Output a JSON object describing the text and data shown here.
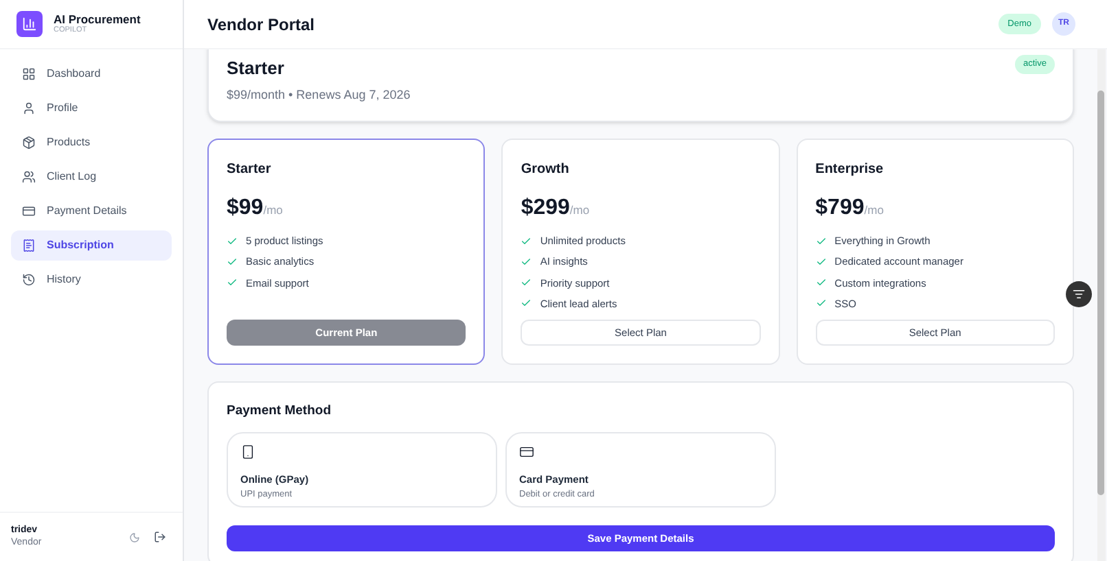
{
  "brand": {
    "name": "AI Procurement",
    "tagline": "COPILOT"
  },
  "sidebar": {
    "items": [
      {
        "label": "Dashboard",
        "kind": "dashboard",
        "selected": false
      },
      {
        "label": "Profile",
        "kind": "user",
        "selected": false
      },
      {
        "label": "Products",
        "kind": "box",
        "selected": false
      },
      {
        "label": "Client Log",
        "kind": "users",
        "selected": false
      },
      {
        "label": "Payment Details",
        "kind": "card",
        "selected": false
      },
      {
        "label": "Subscription",
        "kind": "receipt",
        "selected": true
      },
      {
        "label": "History",
        "kind": "history",
        "selected": false
      }
    ],
    "user": {
      "name": "tridev",
      "role": "Vendor"
    }
  },
  "header": {
    "title": "Vendor Portal",
    "badge": "Demo",
    "avatar": "TR"
  },
  "current_subscription": {
    "plan": "Starter",
    "details": "$99/month • Renews Aug 7, 2026",
    "status": "active"
  },
  "plans": [
    {
      "name": "Starter",
      "price": "$99",
      "period": "/mo",
      "current": true,
      "features": [
        "5 product listings",
        "Basic analytics",
        "Email support"
      ],
      "button": "Current Plan"
    },
    {
      "name": "Growth",
      "price": "$299",
      "period": "/mo",
      "current": false,
      "features": [
        "Unlimited products",
        "AI insights",
        "Priority support",
        "Client lead alerts"
      ],
      "button": "Select Plan"
    },
    {
      "name": "Enterprise",
      "price": "$799",
      "period": "/mo",
      "current": false,
      "features": [
        "Everything in Growth",
        "Dedicated account manager",
        "Custom integrations",
        "SSO"
      ],
      "button": "Select Plan"
    }
  ],
  "payment": {
    "title": "Payment Method",
    "methods": [
      {
        "kind": "phone",
        "title": "Online (GPay)",
        "subtitle": "UPI payment"
      },
      {
        "kind": "card",
        "title": "Card Payment",
        "subtitle": "Debit or credit card"
      }
    ],
    "button": "Save Payment Details"
  }
}
